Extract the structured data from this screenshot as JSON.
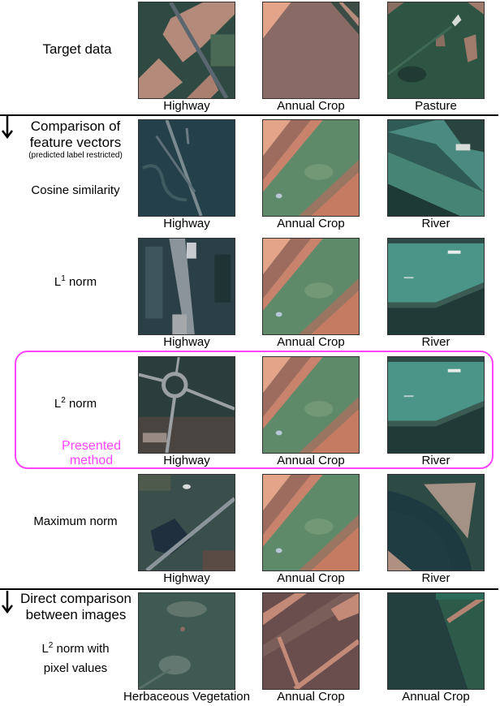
{
  "figure": {
    "columns": 3,
    "rows": [
      {
        "id": "target",
        "label": "Target data",
        "images": [
          {
            "caption": "Highway",
            "scene": "highway-fields"
          },
          {
            "caption": "Annual Crop",
            "scene": "bare-field"
          },
          {
            "caption": "Pasture",
            "scene": "pasture"
          }
        ]
      },
      {
        "id": "cosine",
        "label": "Cosine similarity",
        "images": [
          {
            "caption": "Highway",
            "scene": "highway-dark"
          },
          {
            "caption": "Annual Crop",
            "scene": "crop-stripes"
          },
          {
            "caption": "River",
            "scene": "river-wide"
          }
        ]
      },
      {
        "id": "l1",
        "label_base": "L",
        "label_sup": "1",
        "label_rest": " norm",
        "images": [
          {
            "caption": "Highway",
            "scene": "highway-urban"
          },
          {
            "caption": "Annual Crop",
            "scene": "crop-stripes"
          },
          {
            "caption": "River",
            "scene": "river-boat"
          }
        ]
      },
      {
        "id": "l2",
        "label_base": "L",
        "label_sup": "2",
        "label_rest": " norm",
        "highlight": "Presented method",
        "highlight_line1": "Presented",
        "highlight_line2": "method",
        "highlight_color": "#ff44ff",
        "images": [
          {
            "caption": "Highway",
            "scene": "highway-roundabout"
          },
          {
            "caption": "Annual Crop",
            "scene": "crop-stripes"
          },
          {
            "caption": "River",
            "scene": "river-boat"
          }
        ]
      },
      {
        "id": "max",
        "label": "Maximum norm",
        "images": [
          {
            "caption": "Highway",
            "scene": "highway-lake"
          },
          {
            "caption": "Annual Crop",
            "scene": "crop-stripes"
          },
          {
            "caption": "River",
            "scene": "river-bend"
          }
        ]
      },
      {
        "id": "pixel",
        "label_base": "L",
        "label_sup": "2",
        "label_rest": " norm with",
        "label_line2": "pixel values",
        "images": [
          {
            "caption": "Herbaceous Vegetation",
            "scene": "vegetation"
          },
          {
            "caption": "Annual Crop",
            "scene": "crop-plots"
          },
          {
            "caption": "Annual Crop",
            "scene": "dark-field"
          }
        ]
      }
    ],
    "sections": [
      {
        "title_line1": "Comparison of",
        "title_line2": "feature vectors",
        "note": "(predicted label restricted)"
      },
      {
        "title_line1": "Direct comparison",
        "title_line2": "between images"
      }
    ]
  }
}
